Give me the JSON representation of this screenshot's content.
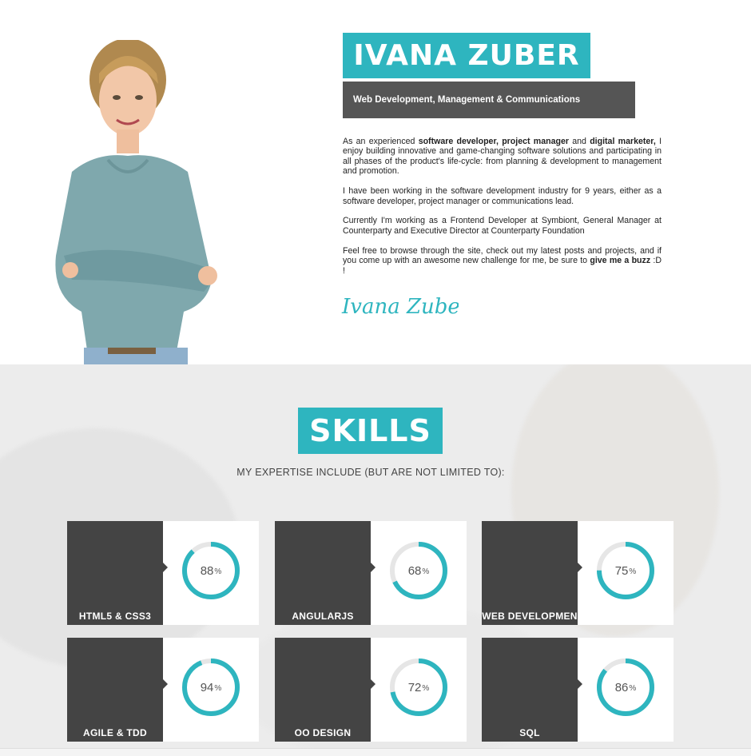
{
  "profile": {
    "name": "IVANA ZUBER",
    "tagline": "Web Development, Management & Communications",
    "bio": {
      "p1_a": "As an experienced ",
      "p1_b": "software developer, project manager",
      "p1_c": " and ",
      "p1_d": "digital marketer,",
      "p1_e": " I enjoy building innovative and game-changing software solutions and participating in all phases of the product's life-cycle: from planning & development to management and promotion.",
      "p2": "I have been working in the software development industry for 9 years, either as a software developer, project manager or communications lead.",
      "p3": "Currently I'm working as a Frontend Developer at Symbiont, General Manager at Counterparty and Executive Director at Counterparty Foundation",
      "p4_a": "Feel free to browse through the site, check out my latest posts and projects, and if you come up with an awesome new challenge for me, be sure to ",
      "p4_b": "give me a buzz",
      "p4_c": " :D !"
    },
    "signature": "Ivana Zuber"
  },
  "skills": {
    "title": "SKILLS",
    "subtitle": "MY EXPERTISE INCLUDE (BUT ARE NOT LIMITED TO):",
    "percent_sign": "%",
    "items": [
      {
        "label": "HTML5 & CSS3",
        "value": 88
      },
      {
        "label": "ANGULARJS",
        "value": 68
      },
      {
        "label": "WEB DEVELOPMEN",
        "value": 75
      },
      {
        "label": "AGILE & TDD",
        "value": 94
      },
      {
        "label": "OO DESIGN",
        "value": 72
      },
      {
        "label": "SQL",
        "value": 86
      }
    ]
  },
  "colors": {
    "accent": "#2eb5bf",
    "dark_panel": "#444444",
    "tagline_bg": "#555555",
    "ring_track": "#e6e6e6"
  }
}
